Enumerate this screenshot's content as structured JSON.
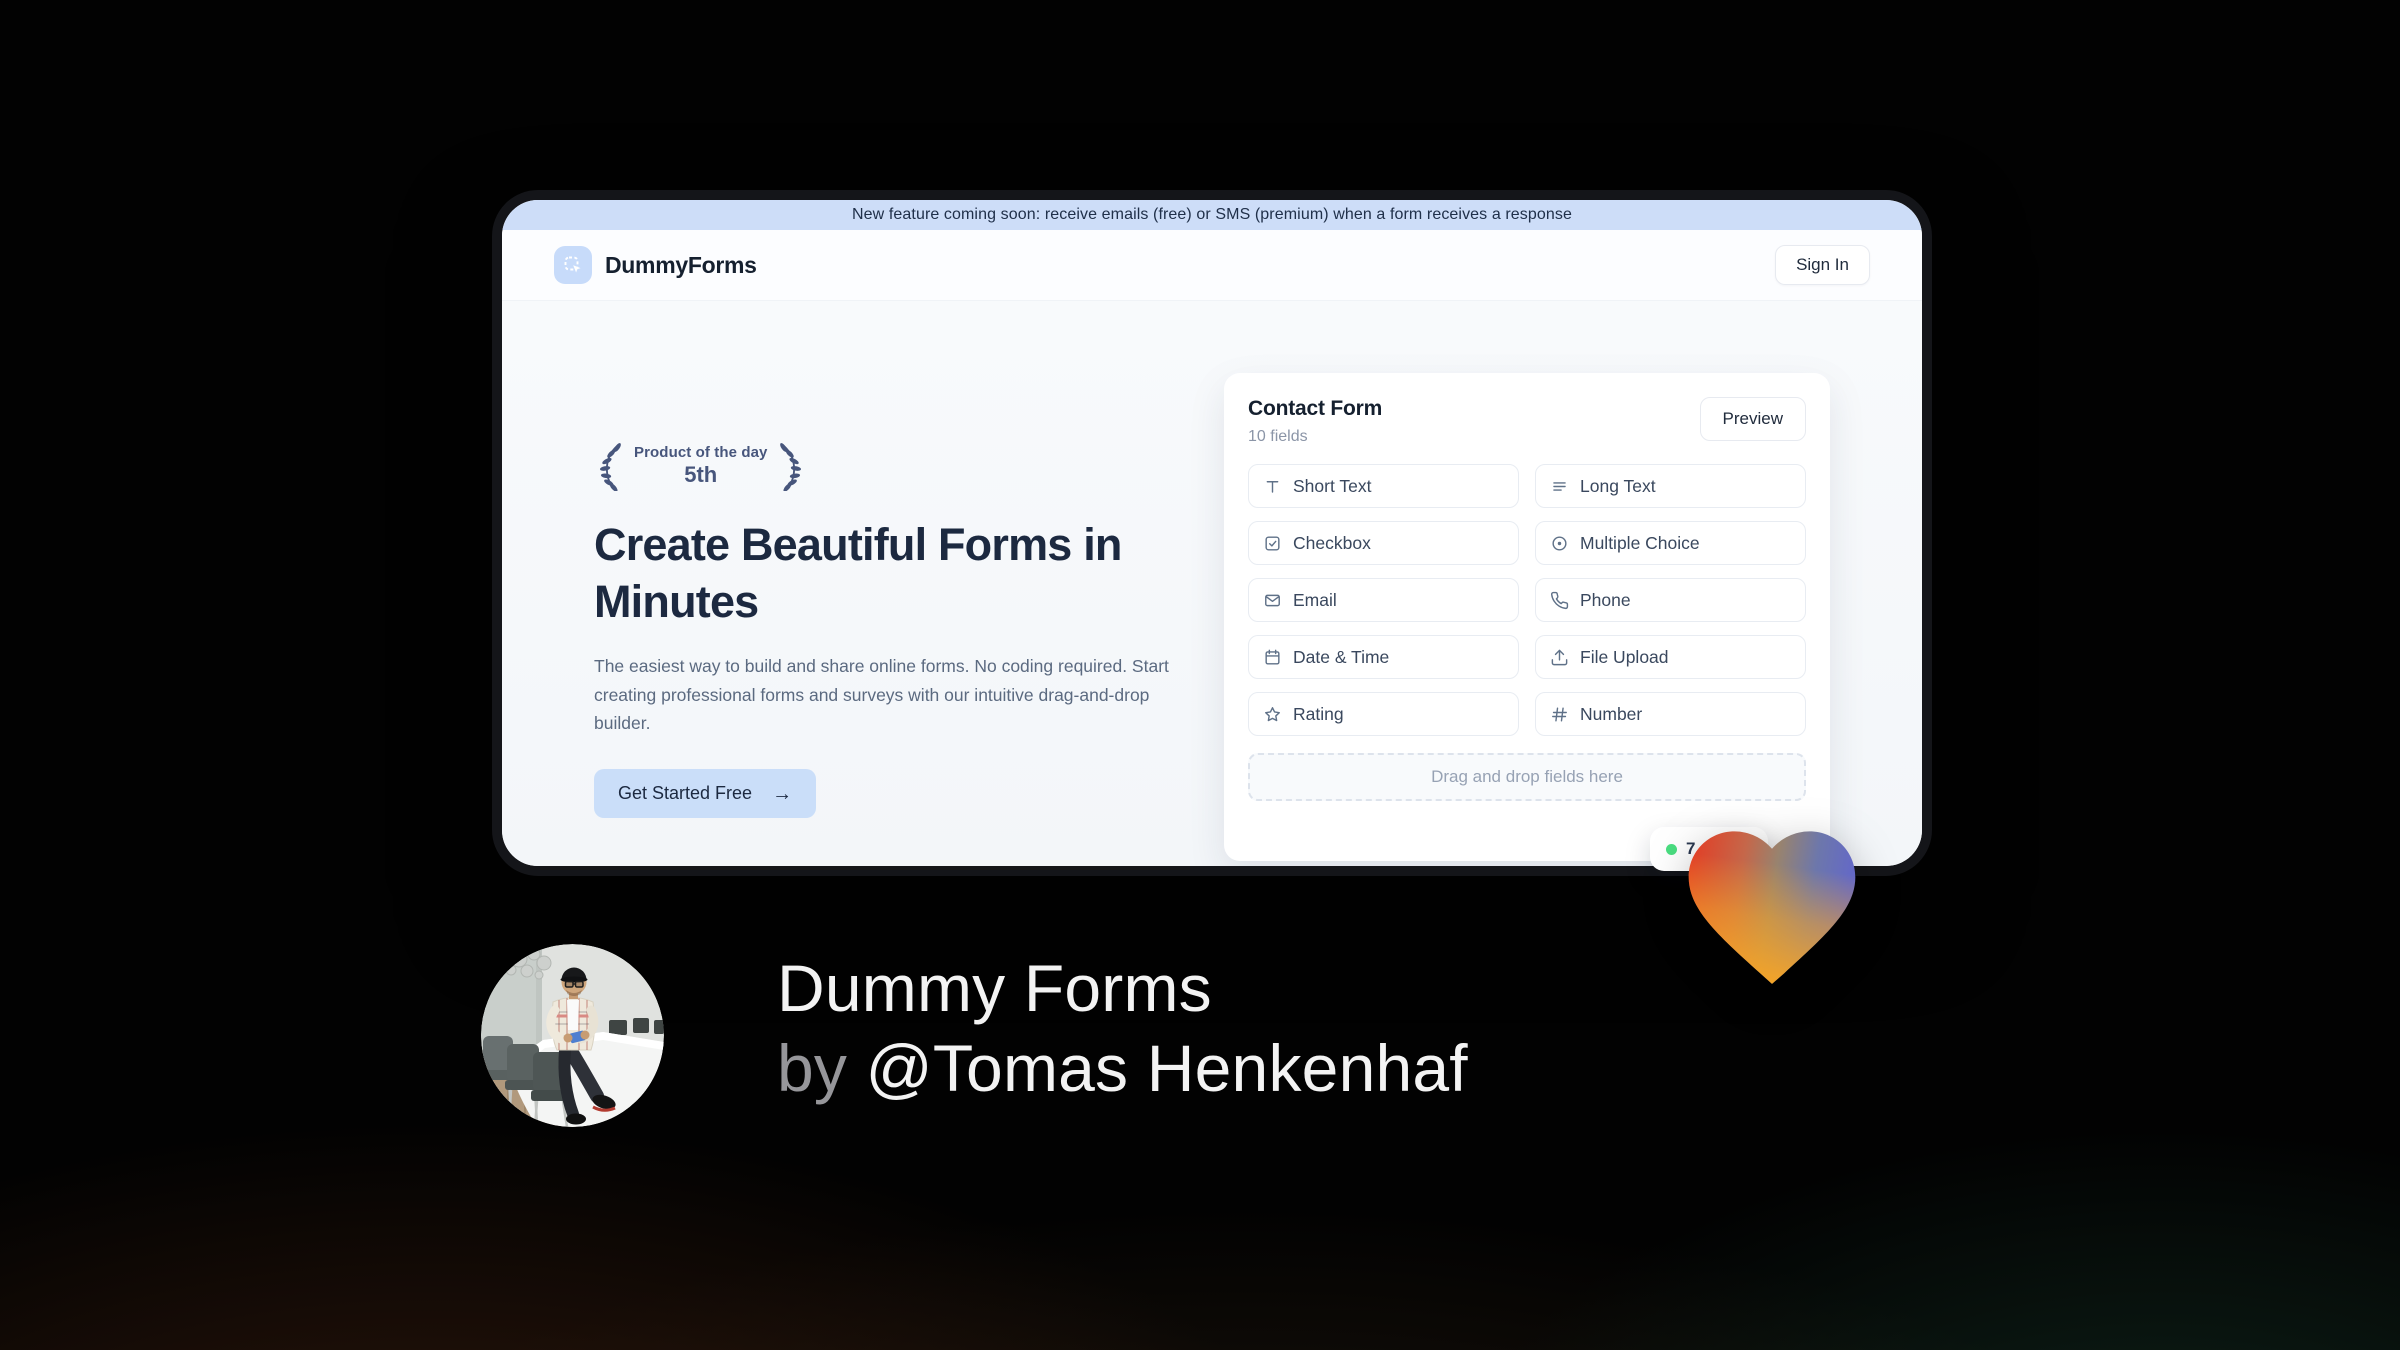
{
  "banner": {
    "text": "New feature coming soon: receive emails (free) or SMS (premium) when a form receives a response"
  },
  "header": {
    "brand": "DummyForms",
    "logo_icon": "dashed-select-cursor-icon",
    "sign_in_label": "Sign In"
  },
  "hero": {
    "badge": {
      "line1": "Product of the day",
      "line2": "5th",
      "icon": "laurel-wreath-icon"
    },
    "title": "Create Beautiful Forms in Minutes",
    "description": "The easiest way to build and share online forms. No coding required. Start creating professional forms and surveys with our intuitive drag-and-drop builder.",
    "cta_label": "Get Started Free",
    "cta_arrow": "→"
  },
  "form_builder": {
    "title": "Contact Form",
    "subtitle": "10 fields",
    "preview_label": "Preview",
    "fields": [
      {
        "label": "Short Text",
        "icon": "text-icon"
      },
      {
        "label": "Long Text",
        "icon": "lines-icon"
      },
      {
        "label": "Checkbox",
        "icon": "checkbox-icon"
      },
      {
        "label": "Multiple Choice",
        "icon": "radio-icon"
      },
      {
        "label": "Email",
        "icon": "envelope-icon"
      },
      {
        "label": "Phone",
        "icon": "phone-icon"
      },
      {
        "label": "Date & Time",
        "icon": "calendar-icon"
      },
      {
        "label": "File Upload",
        "icon": "upload-icon"
      },
      {
        "label": "Rating",
        "icon": "star-icon"
      },
      {
        "label": "Number",
        "icon": "hash-icon"
      }
    ],
    "dropzone_text": "Drag and drop fields here",
    "status_badge": {
      "visible_text": "7",
      "dot_color": "#4ade80"
    }
  },
  "footer": {
    "product_name": "Dummy Forms",
    "byline_prefix": "by ",
    "author": "@Tomas Henkenhaf"
  },
  "colors": {
    "banner_blue": "#cdddf8",
    "logo_blue": "#c7dbfa",
    "cta_blue": "#cadef9",
    "dark_navy": "#1c2940",
    "laurel": "#47567c",
    "status_green": "#4ade80",
    "heart_red": "#e53a22",
    "heart_orange": "#f7a525",
    "heart_blue": "#6469c6",
    "bg_warm_brown": "#2e2112",
    "bg_dark_green": "#102618"
  }
}
